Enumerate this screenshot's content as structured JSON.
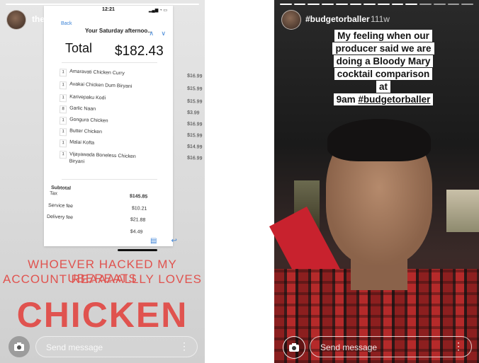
{
  "left_story": {
    "username": "theyoungtraveler",
    "time": "18h",
    "receipt": {
      "status_time": "12:21",
      "back": "Back",
      "subject": "Your Saturday afternoo...",
      "nav": "∧ ∨",
      "total_label": "Total",
      "total_value": "$182.43",
      "items": [
        {
          "qty": "1",
          "name": "Amaravati Chicken Curry",
          "price": "$16.99"
        },
        {
          "qty": "1",
          "name": "Avakai Chicken Dum Biryani",
          "price": "$15.99"
        },
        {
          "qty": "1",
          "name": "Karivepaku Kodi",
          "price": "$15.99"
        },
        {
          "qty": "8",
          "name": "Garlic Naan",
          "price": "$3.99"
        },
        {
          "qty": "1",
          "name": "Gongura Chicken",
          "price": "$16.99"
        },
        {
          "qty": "1",
          "name": "Butter Chicken",
          "price": "$15.99"
        },
        {
          "qty": "1",
          "name": "Malai Kofta",
          "price": "$14.99"
        },
        {
          "qty": "1",
          "name": "Vijayawada Boneless Chicken Biryani",
          "price": "$16.99"
        }
      ],
      "summary": [
        {
          "label": "Subtotal",
          "value": ""
        },
        {
          "label": "Tax",
          "value": "$145.85"
        },
        {
          "label": "Service fee",
          "value": "$10.21"
        },
        {
          "label": "Delivery fee",
          "value": "$21.88"
        },
        {
          "label": "",
          "value": "$4.49"
        }
      ]
    },
    "caption_line1": "WHOEVER HACKED MY UBEREATS",
    "caption_line2": "ACCOUNT REAAAALLLY LOVES",
    "caption_big": "CHICKEN",
    "reply_placeholder": "Send message"
  },
  "right_story": {
    "username": "#budgetorballer",
    "time": "111w",
    "sticker_lines": [
      "My feeling when our",
      "producer said we are",
      "doing a Bloody Mary",
      "cocktail comparison at"
    ],
    "sticker_last_plain": "9am ",
    "sticker_hashtag": "#budgetorballer",
    "reply_placeholder": "Send message"
  },
  "colors": {
    "caption": "#e0534f",
    "accent": "#3b82d6"
  }
}
